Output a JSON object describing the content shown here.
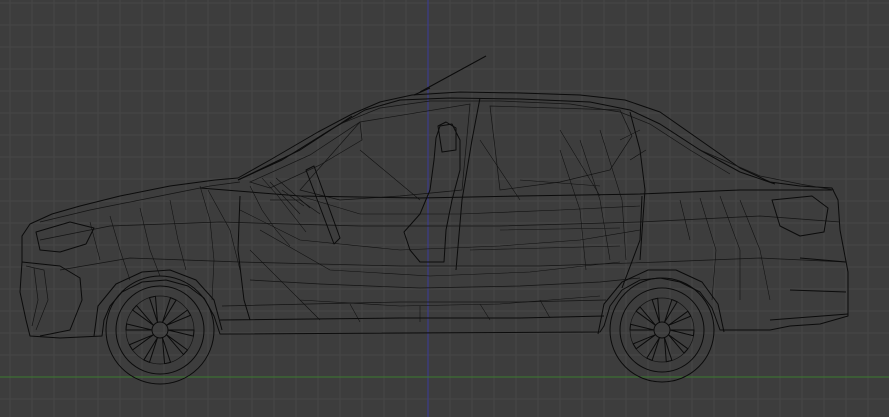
{
  "viewport": {
    "view": "side-orthographic",
    "shading": "wireframe",
    "subject": "sedan-wireframe-model",
    "colors": {
      "background": "#3d3d3d",
      "grid": "#474747",
      "wire": "#0b0b0b",
      "z_axis": "#3b3b9a",
      "ground_axis": "#3c7a2e"
    },
    "grid_visible": true
  }
}
